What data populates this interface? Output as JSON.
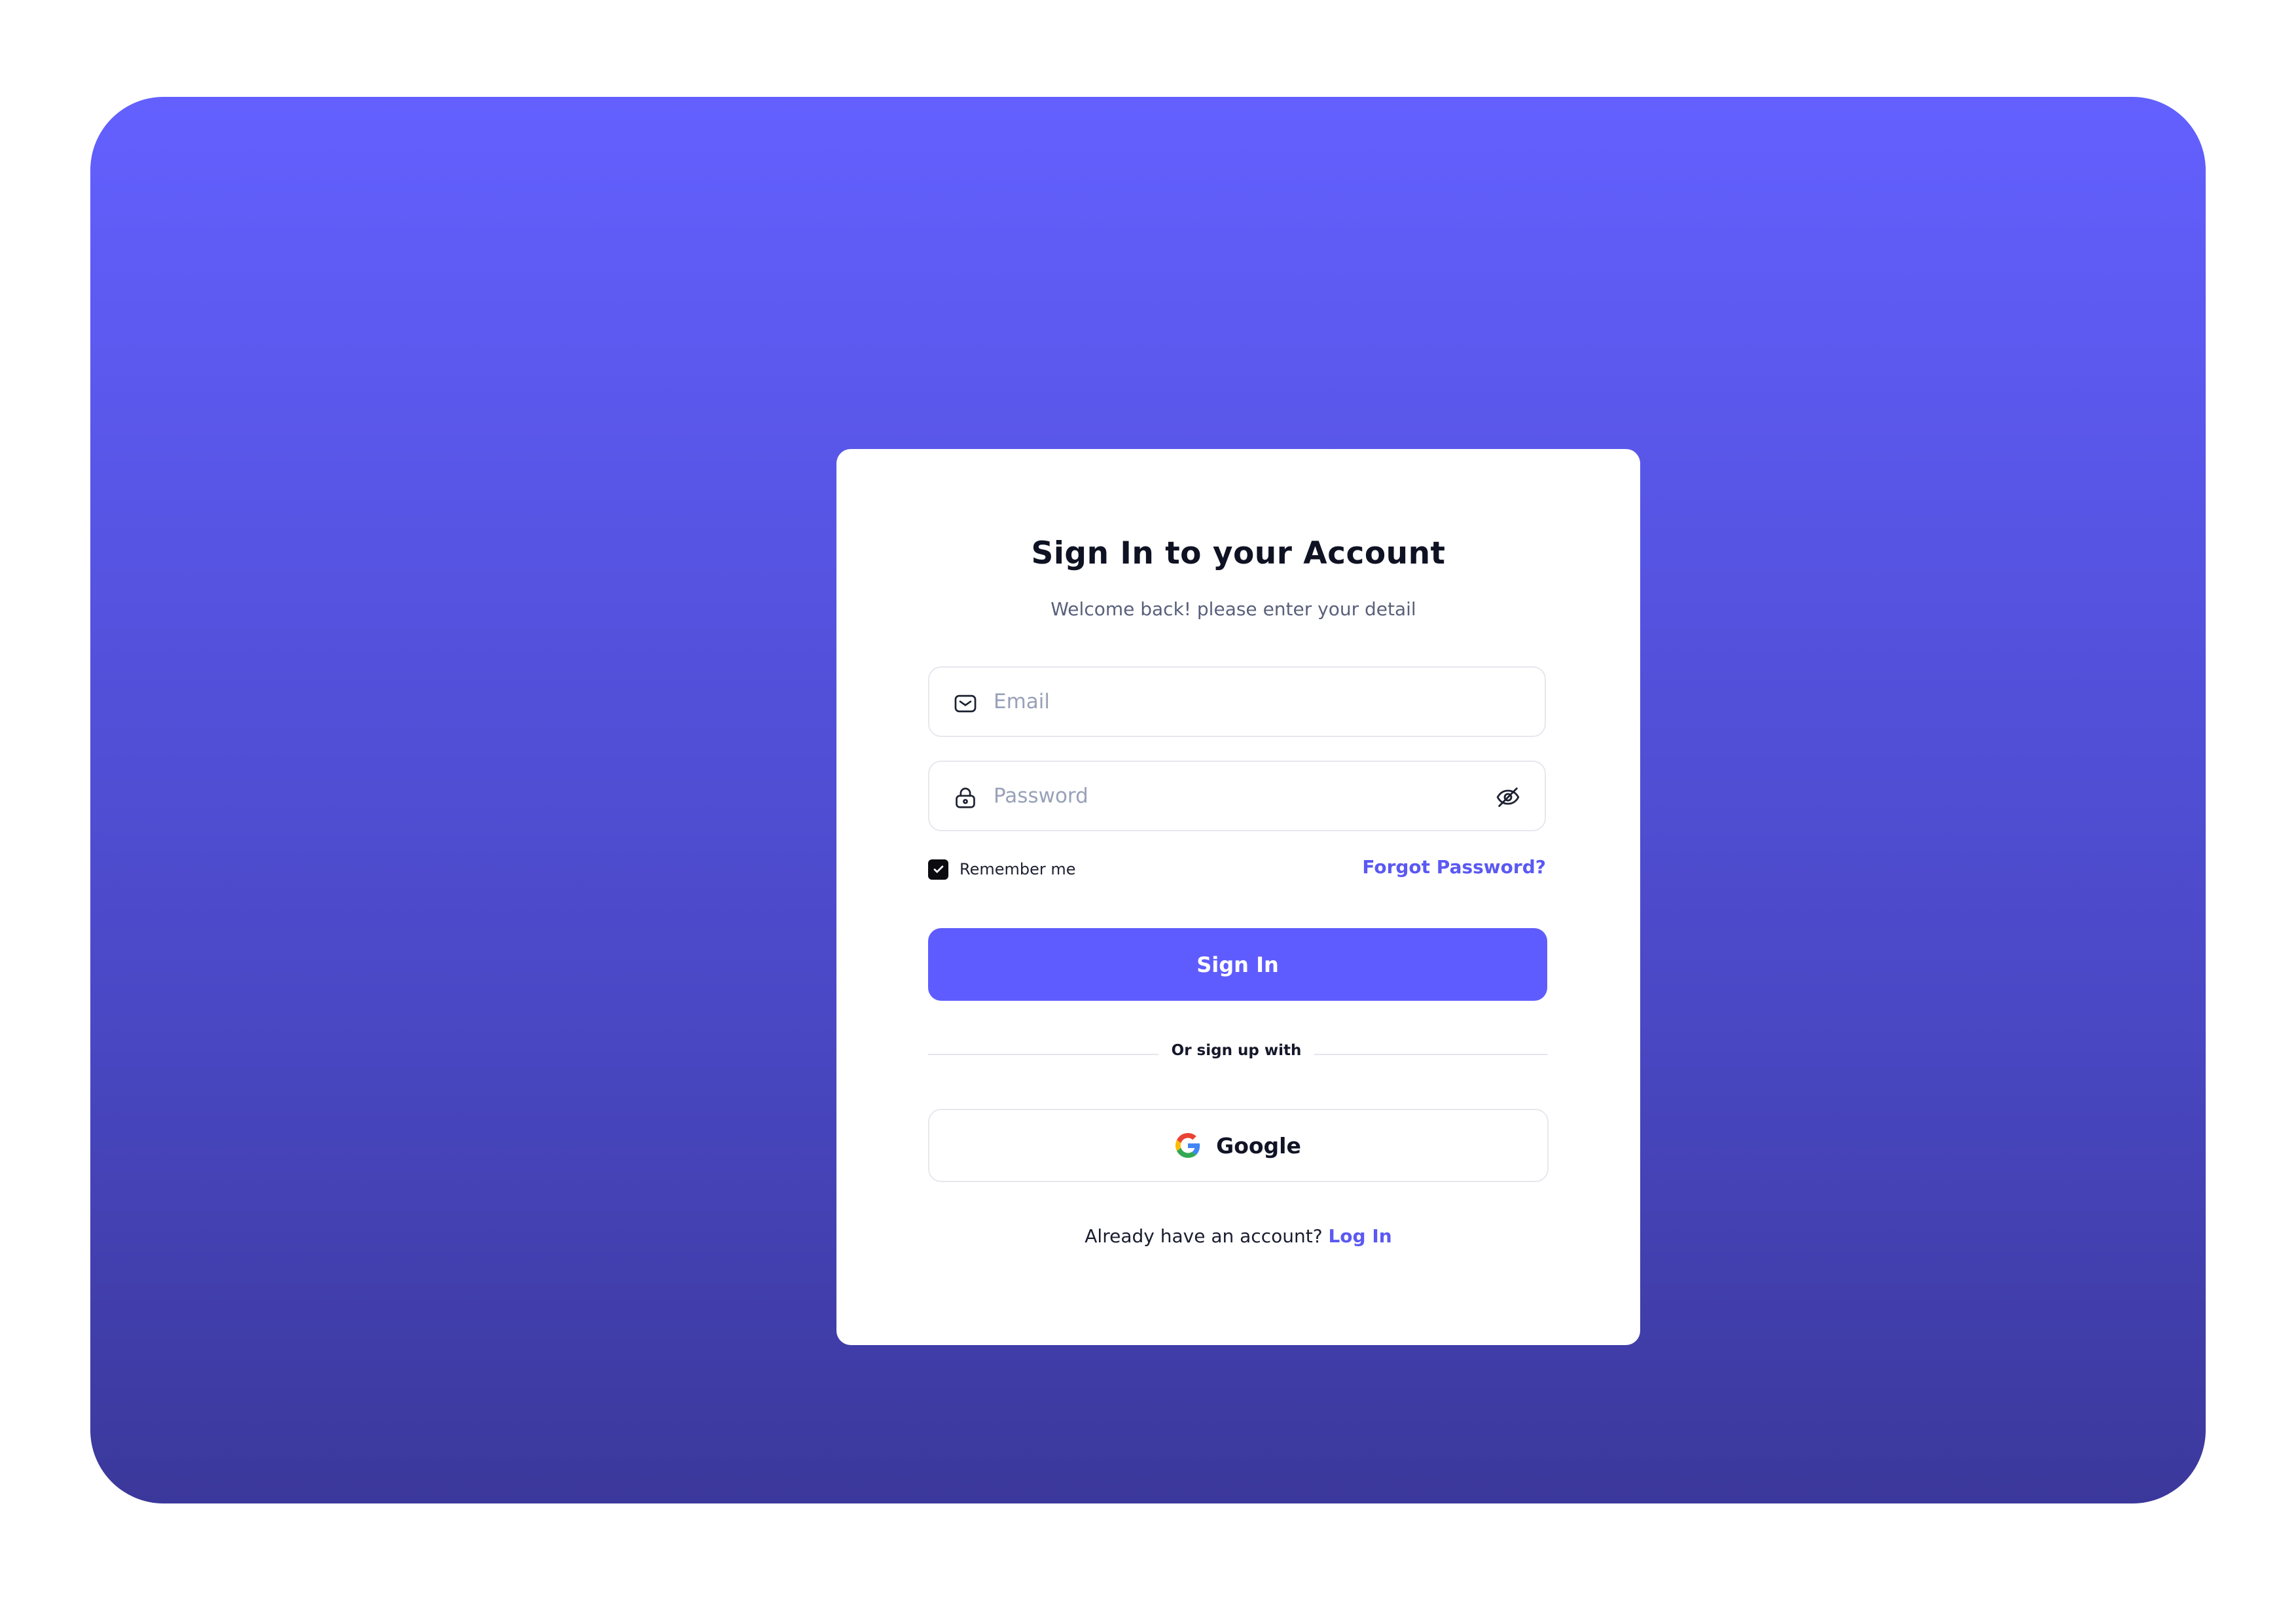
{
  "card": {
    "title": "Sign In to your Account",
    "subtitle": "Welcome back! please enter your detail"
  },
  "email_field": {
    "placeholder": "Email",
    "value": "",
    "icon": "mail-icon"
  },
  "password_field": {
    "placeholder": "Password",
    "value": "",
    "icon": "lock-icon",
    "toggle_icon": "eye-off-icon"
  },
  "remember": {
    "label": "Remember me",
    "checked": true
  },
  "forgot_link": "Forgot Password?",
  "signin_button": "Sign In",
  "divider": "Or sign up with",
  "google_button": {
    "label": "Google",
    "icon": "google-icon"
  },
  "footer": {
    "text": "Already have an account?",
    "link": "Log In"
  },
  "colors": {
    "accent": "#5f5cff",
    "link": "#5b59f2",
    "gradient_top": "#6360ff",
    "gradient_bottom": "#3b389b"
  }
}
